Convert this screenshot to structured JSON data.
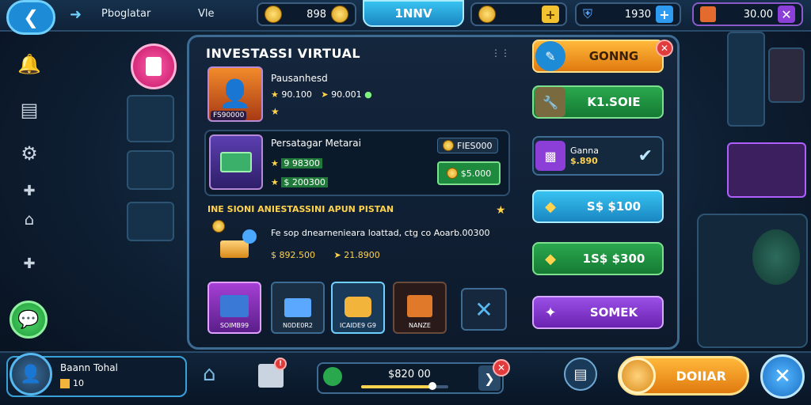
{
  "topbar": {
    "title": "Pboglatar",
    "nav_label": "Vle",
    "coins_value": "898",
    "active_tab": "1NNV",
    "shield_value": "1930",
    "cash_value": "30.00"
  },
  "panel": {
    "title": "INVESTASSI VIRTUAL",
    "card1": {
      "name": "Pausanhesd",
      "stat1": "90.100",
      "stat2": "90.001",
      "badge": "FS90000"
    },
    "card2": {
      "name": "Persatagar Metarai",
      "stat1": "9 98300",
      "stat2": "$ 200300",
      "price_label": "FIES000",
      "button": "$5.000"
    },
    "section": {
      "header": "INE SIONI ANIESTASSINI APUN PISTAN",
      "desc": "Fe sop dnearnenieara loattad, ctg co Aoarb.00300",
      "value1": "$ 892.500",
      "value2": "21.8900"
    },
    "items": [
      {
        "label": "SOIMB99"
      },
      {
        "label": "N0DE0R2"
      },
      {
        "label": "ICAIDE9 G9"
      },
      {
        "label": "NANZE"
      }
    ]
  },
  "right_column": {
    "btn1": "GONNG",
    "btn2": "K1.SOIE",
    "btn3_title": "Ganna",
    "btn3_value": "$.890",
    "btn4": "S$ $100",
    "btn5": "1S$ $300",
    "btn6": "SOMEK"
  },
  "bottom": {
    "profile_name": "Baann Tohal",
    "profile_level": "10",
    "slider_value": "$820 00",
    "slider_fraction": 0.82,
    "claim_label": "DOIIAR"
  },
  "colors": {
    "accent_blue": "#1e8bd6",
    "gold": "#ffd34d",
    "green": "#2aa84e",
    "purple": "#8b3fd6",
    "orange": "#f29a1c"
  }
}
